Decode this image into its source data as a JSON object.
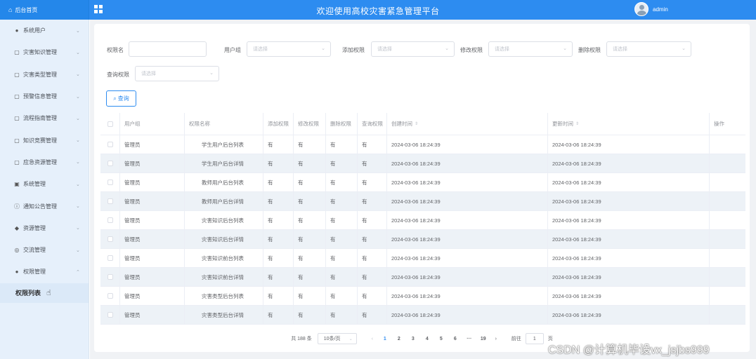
{
  "header": {
    "brand": "后台首页",
    "title": "欢迎使用高校灾害紧急管理平台",
    "username": "admin"
  },
  "sidebar": {
    "items": [
      {
        "label": "系统用户",
        "icon": "user-icon"
      },
      {
        "label": "灾害知识管理",
        "icon": "doc-icon"
      },
      {
        "label": "灾害类型管理",
        "icon": "doc-icon"
      },
      {
        "label": "预警信息管理",
        "icon": "doc-icon"
      },
      {
        "label": "流程指南管理",
        "icon": "doc-icon"
      },
      {
        "label": "知识竞赛管理",
        "icon": "doc-icon"
      },
      {
        "label": "应急资源管理",
        "icon": "doc-icon"
      },
      {
        "label": "系统管理",
        "icon": "image-icon"
      },
      {
        "label": "通知公告管理",
        "icon": "info-icon"
      },
      {
        "label": "资源管理",
        "icon": "shield-icon"
      },
      {
        "label": "交流管理",
        "icon": "chat-icon"
      },
      {
        "label": "权限管理",
        "icon": "user-icon"
      }
    ],
    "active_sub": "权限列表"
  },
  "search": {
    "name_label": "权限名",
    "name_value": "",
    "group_label": "用户组",
    "add_label": "添加权限",
    "edit_label": "修改权限",
    "delete_label": "删除权限",
    "query_label": "查询权限",
    "placeholder": "请选择",
    "button": "查询"
  },
  "table": {
    "headers": [
      "用户组",
      "权限名称",
      "添加权限",
      "修改权限",
      "删除权限",
      "查询权限",
      "创建时间",
      "更新时间",
      "操作"
    ],
    "rows": [
      [
        "管理员",
        "学生用户后台列表",
        "有",
        "有",
        "有",
        "有",
        "2024-03-06 18:24:39",
        "2024-03-06 18:24:39"
      ],
      [
        "管理员",
        "学生用户后台详情",
        "有",
        "有",
        "有",
        "有",
        "2024-03-06 18:24:39",
        "2024-03-06 18:24:39"
      ],
      [
        "管理员",
        "教师用户后台列表",
        "有",
        "有",
        "有",
        "有",
        "2024-03-06 18:24:39",
        "2024-03-06 18:24:39"
      ],
      [
        "管理员",
        "教师用户后台详情",
        "有",
        "有",
        "有",
        "有",
        "2024-03-06 18:24:39",
        "2024-03-06 18:24:39"
      ],
      [
        "管理员",
        "灾害知识后台列表",
        "有",
        "有",
        "有",
        "有",
        "2024-03-06 18:24:39",
        "2024-03-06 18:24:39"
      ],
      [
        "管理员",
        "灾害知识后台详情",
        "有",
        "有",
        "有",
        "有",
        "2024-03-06 18:24:39",
        "2024-03-06 18:24:39"
      ],
      [
        "管理员",
        "灾害知识前台列表",
        "有",
        "有",
        "有",
        "有",
        "2024-03-06 18:24:39",
        "2024-03-06 18:24:39"
      ],
      [
        "管理员",
        "灾害知识前台详情",
        "有",
        "有",
        "有",
        "有",
        "2024-03-06 18:24:39",
        "2024-03-06 18:24:39"
      ],
      [
        "管理员",
        "灾害类型后台列表",
        "有",
        "有",
        "有",
        "有",
        "2024-03-06 18:24:39",
        "2024-03-06 18:24:39"
      ],
      [
        "管理员",
        "灾害类型后台详情",
        "有",
        "有",
        "有",
        "有",
        "2024-03-06 18:24:39",
        "2024-03-06 18:24:39"
      ]
    ]
  },
  "pagination": {
    "total": "共 188 条",
    "page_size": "10条/页",
    "pages": [
      "1",
      "2",
      "3",
      "4",
      "5",
      "6",
      "···",
      "19"
    ],
    "current": "1",
    "goto_label": "前往",
    "goto_value": "1",
    "page_unit": "页"
  },
  "watermark": "CSDN @计算机毕设vx_jsjbs999"
}
